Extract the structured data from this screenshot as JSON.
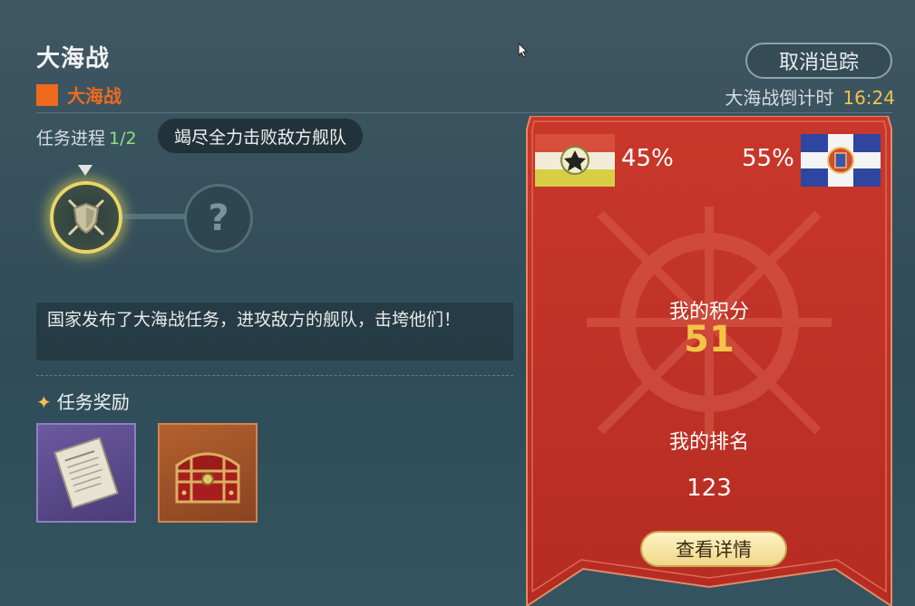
{
  "header": {
    "title": "大海战",
    "subtitle": "大海战",
    "cancel_button": "取消追踪",
    "countdown_label": "大海战倒计时",
    "countdown_time": "16:24"
  },
  "task": {
    "progress_label": "任务进程",
    "progress_value": "1/2",
    "objective": "竭尽全力击败敌方舰队",
    "description": "国家发布了大海战任务，进攻敌方的舰队，击垮他们！",
    "reward_title": "任务奖励",
    "nodes": [
      {
        "icon": "crossed-swords-shield-icon",
        "state": "active"
      },
      {
        "icon": "question-mark-icon",
        "state": "locked",
        "glyph": "?"
      }
    ],
    "rewards": [
      {
        "icon": "document-icon",
        "rarity_color": "#6a5a9e"
      },
      {
        "icon": "treasure-chest-icon",
        "rarity_color": "#b4602e"
      }
    ]
  },
  "battle": {
    "left_percent": "45%",
    "right_percent": "55%",
    "score_label": "我的积分",
    "score_value": "51",
    "rank_label": "我的排名",
    "rank_value": "123",
    "detail_button": "查看详情"
  },
  "colors": {
    "accent_orange": "#f06a1e",
    "gold": "#f5c346",
    "progress_green": "#8ee07a",
    "banner_red": "#c8352a"
  }
}
